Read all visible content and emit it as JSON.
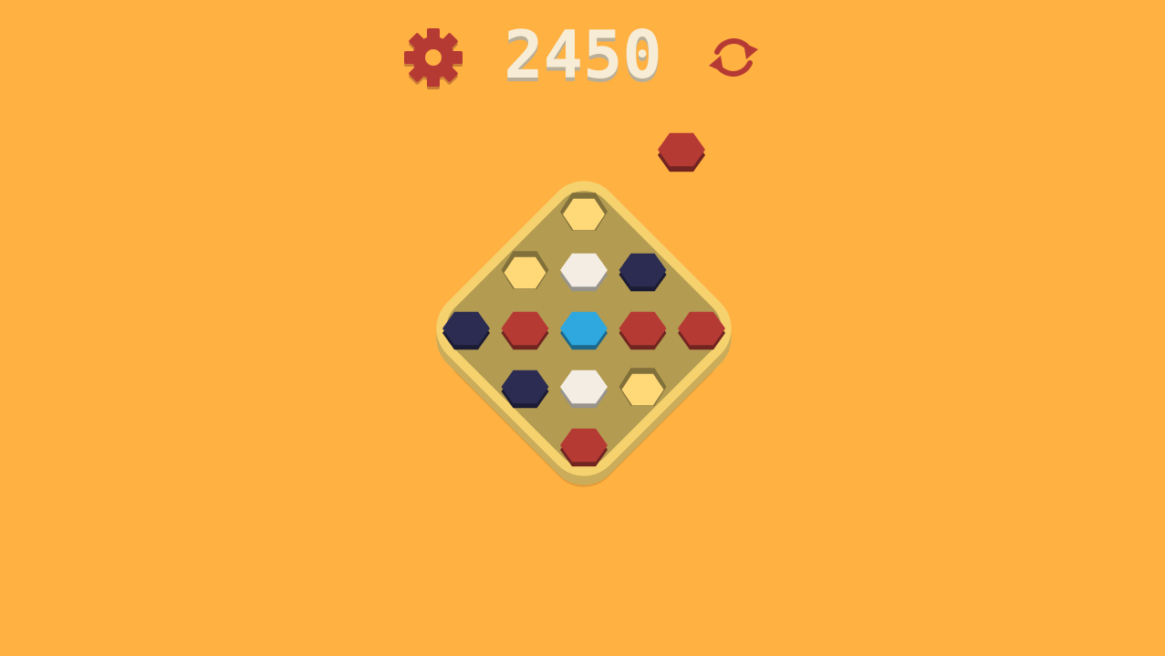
{
  "hud": {
    "score": "2450",
    "settings_icon": "gear-icon",
    "restart_icon": "restart-icon"
  },
  "colors": {
    "background": "#FFB142",
    "board_rim": "#F6D26E",
    "board_surface": "#B39B51",
    "board_shadow": "#E69A35",
    "icon": "#B63A34",
    "score_text": "#F7EDD6",
    "score_shadow": "#B9AE97"
  },
  "pieces": {
    "red": "#B63A34",
    "navy": "#2C2C52",
    "white": "#F4EDE3",
    "blue": "#2EA8DF",
    "yellow": "#FFD878"
  },
  "board": {
    "cells": [
      {
        "id": "r0-c0",
        "color": "yellow",
        "empty": true
      },
      {
        "id": "r1-c0",
        "color": "yellow",
        "empty": true
      },
      {
        "id": "r1-c1",
        "color": "white",
        "empty": false
      },
      {
        "id": "r1-c2",
        "color": "navy",
        "empty": false
      },
      {
        "id": "r2-c0",
        "color": "navy",
        "empty": false
      },
      {
        "id": "r2-c1",
        "color": "red",
        "empty": false
      },
      {
        "id": "r2-c2",
        "color": "blue",
        "empty": false
      },
      {
        "id": "r2-c3",
        "color": "red",
        "empty": false
      },
      {
        "id": "r2-c4",
        "color": "red",
        "empty": false
      },
      {
        "id": "r3-c0",
        "color": "navy",
        "empty": false
      },
      {
        "id": "r3-c1",
        "color": "white",
        "empty": false
      },
      {
        "id": "r3-c2",
        "color": "yellow",
        "empty": true
      },
      {
        "id": "r4-c0",
        "color": "red",
        "empty": false
      }
    ]
  },
  "next_piece": {
    "color": "red"
  }
}
